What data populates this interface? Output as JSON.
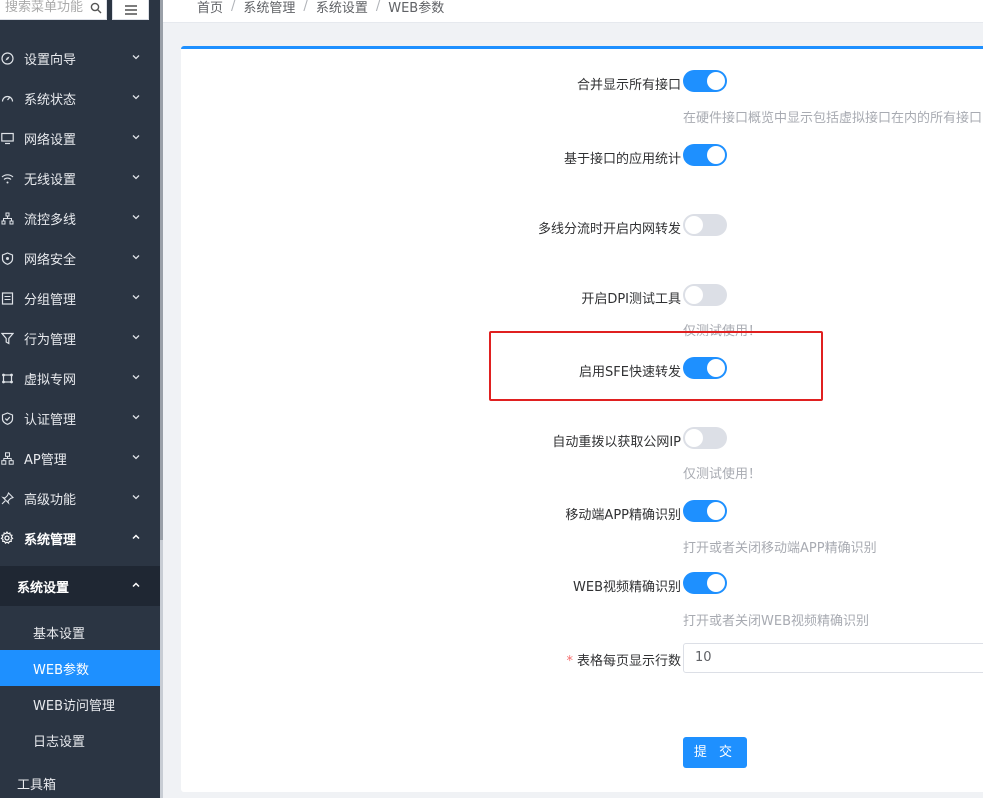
{
  "sidebar": {
    "search_placeholder": "搜索菜单功能",
    "items": [
      {
        "label": "设置向导",
        "icon": "compass-icon"
      },
      {
        "label": "系统状态",
        "icon": "gauge-icon"
      },
      {
        "label": "网络设置",
        "icon": "monitor-icon"
      },
      {
        "label": "无线设置",
        "icon": "wifi-icon"
      },
      {
        "label": "流控多线",
        "icon": "network-tree-icon"
      },
      {
        "label": "网络安全",
        "icon": "shield-icon"
      },
      {
        "label": "分组管理",
        "icon": "group-icon"
      },
      {
        "label": "行为管理",
        "icon": "filter-icon"
      },
      {
        "label": "虚拟专网",
        "icon": "vpn-icon"
      },
      {
        "label": "认证管理",
        "icon": "shield-check-icon"
      },
      {
        "label": "AP管理",
        "icon": "topology-icon"
      },
      {
        "label": "高级功能",
        "icon": "pin-icon"
      },
      {
        "label": "系统管理",
        "icon": "gear-icon"
      }
    ],
    "submenu_header": "系统设置",
    "sub_items": [
      {
        "label": "基本设置",
        "active": false
      },
      {
        "label": "WEB参数",
        "active": true
      },
      {
        "label": "WEB访问管理",
        "active": false
      },
      {
        "label": "日志设置",
        "active": false
      }
    ],
    "tools_label": "工具箱"
  },
  "breadcrumb": [
    "首页",
    "系统管理",
    "系统设置",
    "WEB参数"
  ],
  "form": {
    "rows": [
      {
        "label": "合并显示所有接口",
        "on": true,
        "hint": "在硬件接口概览中显示包括虚拟接口在内的所有接口"
      },
      {
        "label": "基于接口的应用统计",
        "on": true,
        "hint": ""
      },
      {
        "label": "多线分流时开启内网转发",
        "on": false,
        "hint": ""
      },
      {
        "label": "开启DPI测试工具",
        "on": false,
        "hint": "仅测试使用！"
      },
      {
        "label": "启用SFE快速转发",
        "on": true,
        "hint": ""
      },
      {
        "label": "自动重拨以获取公网IP",
        "on": false,
        "hint": "仅测试使用！"
      },
      {
        "label": "移动端APP精确识别",
        "on": true,
        "hint": "打开或者关闭移动端APP精确识别"
      },
      {
        "label": "WEB视频精确识别",
        "on": true,
        "hint": "打开或者关闭WEB视频精确识别"
      }
    ],
    "rows_per_page_label": "表格每页显示行数",
    "required_mark": "*",
    "rows_per_page_value": "10",
    "submit_label": "提 交"
  }
}
